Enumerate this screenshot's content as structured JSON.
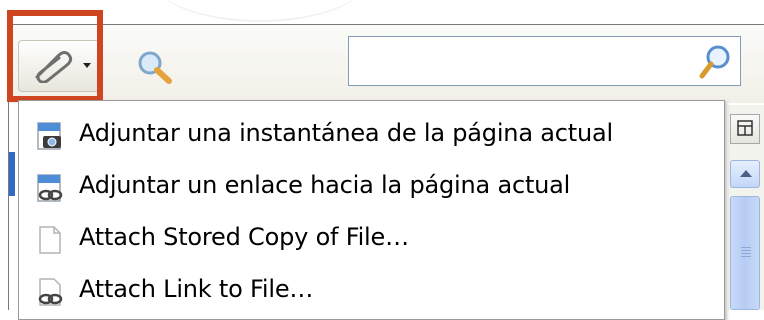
{
  "toolbar": {
    "attach_button": {
      "icon": "paperclip-icon",
      "has_dropdown": true,
      "highlighted": true
    },
    "search_toggle": {
      "icon": "magnifier-icon"
    },
    "search_input": {
      "value": "",
      "placeholder": "",
      "icon": "search-icon"
    },
    "highlight_color": "#cf4520"
  },
  "attach_menu": {
    "items": [
      {
        "label": "Adjuntar una instantánea de la página actual",
        "icon": "page-snapshot-icon"
      },
      {
        "label": "Adjuntar un enlace hacia la página actual",
        "icon": "page-link-icon"
      },
      {
        "label": "Attach Stored Copy of File…",
        "icon": "blank-file-icon"
      },
      {
        "label": "Attach Link to File…",
        "icon": "file-link-icon"
      }
    ]
  },
  "right_panel": {
    "column_picker_icon": "column-picker-icon",
    "scrollbar": {
      "up_arrow_icon": "scroll-up-icon"
    },
    "selection_color": "#3169c6"
  }
}
